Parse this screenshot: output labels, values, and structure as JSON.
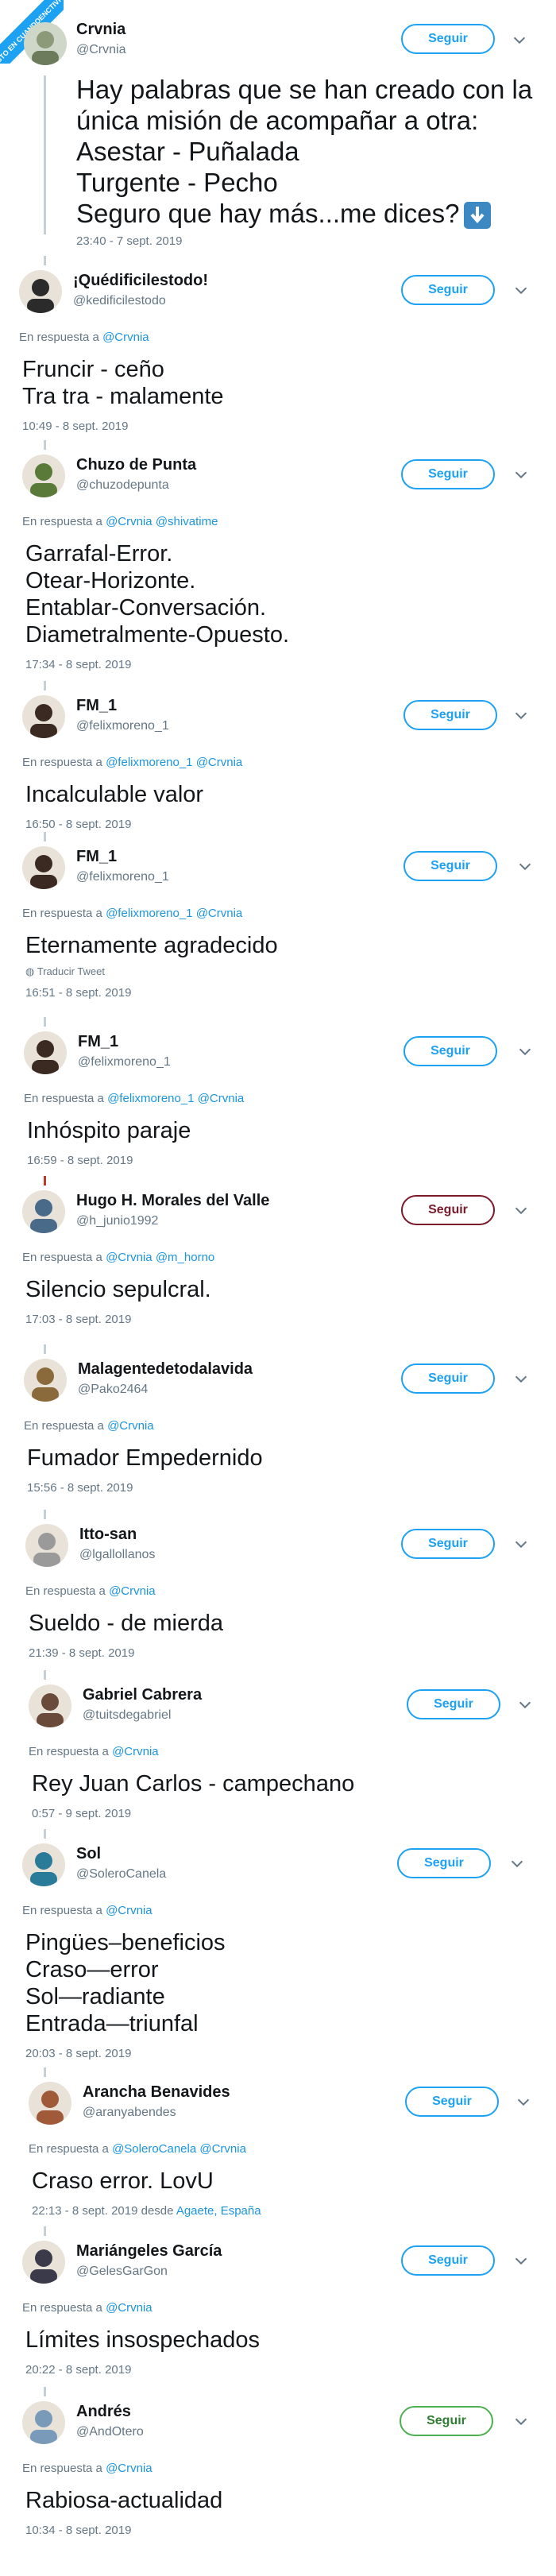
{
  "badge": {
    "text": "VISTO EN CUANDOENCTIVISTA"
  },
  "follow_label": "Seguir",
  "reply_prefix": "En respuesta a",
  "main": {
    "name": "Crvnia",
    "handle": "@Crvnia",
    "text": "Hay palabras que se han creado con la\núnica misión de acompañar a otra:\nAsestar - Puñalada\nTurgente - Pecho\nSeguro que hay más...me dices?",
    "time": "23:40 - 7 sept. 2019"
  },
  "tweets": [
    {
      "name": "¡Quédificilestodo!",
      "handle": "@kedificilestodo",
      "mentions": "@Crvnia",
      "text": "Fruncir - ceño\nTra tra - malamente",
      "time": "10:49 - 8 sept. 2019"
    },
    {
      "name": "Chuzo de Punta",
      "handle": "@chuzodepunta",
      "mentions": "@Crvnia @shivatime",
      "text": "Garrafal-Error.\nOtear-Horizonte.\nEntablar-Conversación.\nDiametralmente-Opuesto.",
      "time": "17:34 - 8 sept. 2019"
    },
    {
      "name": "FM_1",
      "handle": "@felixmoreno_1",
      "mentions": "@felixmoreno_1 @Crvnia",
      "text": "Incalculable valor",
      "time": "16:50 - 8 sept. 2019"
    },
    {
      "name": "FM_1",
      "handle": "@felixmoreno_1",
      "mentions": "@felixmoreno_1 @Crvnia",
      "text": "Eternamente agradecido",
      "translate": "Traducir Tweet",
      "time": "16:51 - 8 sept. 2019"
    },
    {
      "name": "FM_1",
      "handle": "@felixmoreno_1",
      "mentions": "@felixmoreno_1 @Crvnia",
      "text": "Inhóspito paraje",
      "time": "16:59 - 8 sept. 2019"
    },
    {
      "name": "Hugo H. Morales del Valle",
      "handle": "@h_junio1992",
      "mentions": "@Crvnia @m_horno",
      "text": "Silencio sepulcral.",
      "time": "17:03 - 8 sept. 2019"
    },
    {
      "name": "Malagentedetodalavida",
      "handle": "@Pako2464",
      "mentions": "@Crvnia",
      "text": "Fumador Empedernido",
      "time": "15:56 - 8 sept. 2019"
    },
    {
      "name": "Itto-san",
      "handle": "@lgallollanos",
      "mentions": "@Crvnia",
      "text": "Sueldo - de mierda",
      "time": "21:39 - 8 sept. 2019"
    },
    {
      "name": "Gabriel Cabrera",
      "handle": "@tuitsdegabriel",
      "mentions": "@Crvnia",
      "text": "Rey Juan Carlos - campechano",
      "time": "0:57 - 9 sept. 2019"
    },
    {
      "name": "Sol",
      "handle": "@SoleroCanela",
      "mentions": "@Crvnia",
      "text": "Pingües–beneficios\nCraso—error\nSol—radiante\nEntrada—triunfal",
      "time": "20:03 - 8 sept. 2019"
    },
    {
      "name": "Arancha Benavides",
      "handle": "@aranyabendes",
      "mentions": "@SoleroCanela @Crvnia",
      "text": "Craso error. LovU",
      "time": "22:13 - 8 sept. 2019 desde ",
      "location": "Agaete, España"
    },
    {
      "name": "Mariángeles García",
      "handle": "@GelesGarGon",
      "mentions": "@Crvnia",
      "text": "Límites insospechados",
      "time": "20:22 - 8 sept. 2019"
    },
    {
      "name": "Andrés",
      "handle": "@AndOtero",
      "mentions": "@Crvnia",
      "text": "Rabiosa-actualidad",
      "time": "10:34 - 8 sept. 2019"
    }
  ],
  "colors": {
    "link": "#1b95e0",
    "follow": "#1da1f2",
    "muted": "#657786"
  },
  "icons": {
    "chevron": "chevron-down-icon",
    "globe": "globe-icon",
    "arrow": "down-arrow-emoji"
  }
}
